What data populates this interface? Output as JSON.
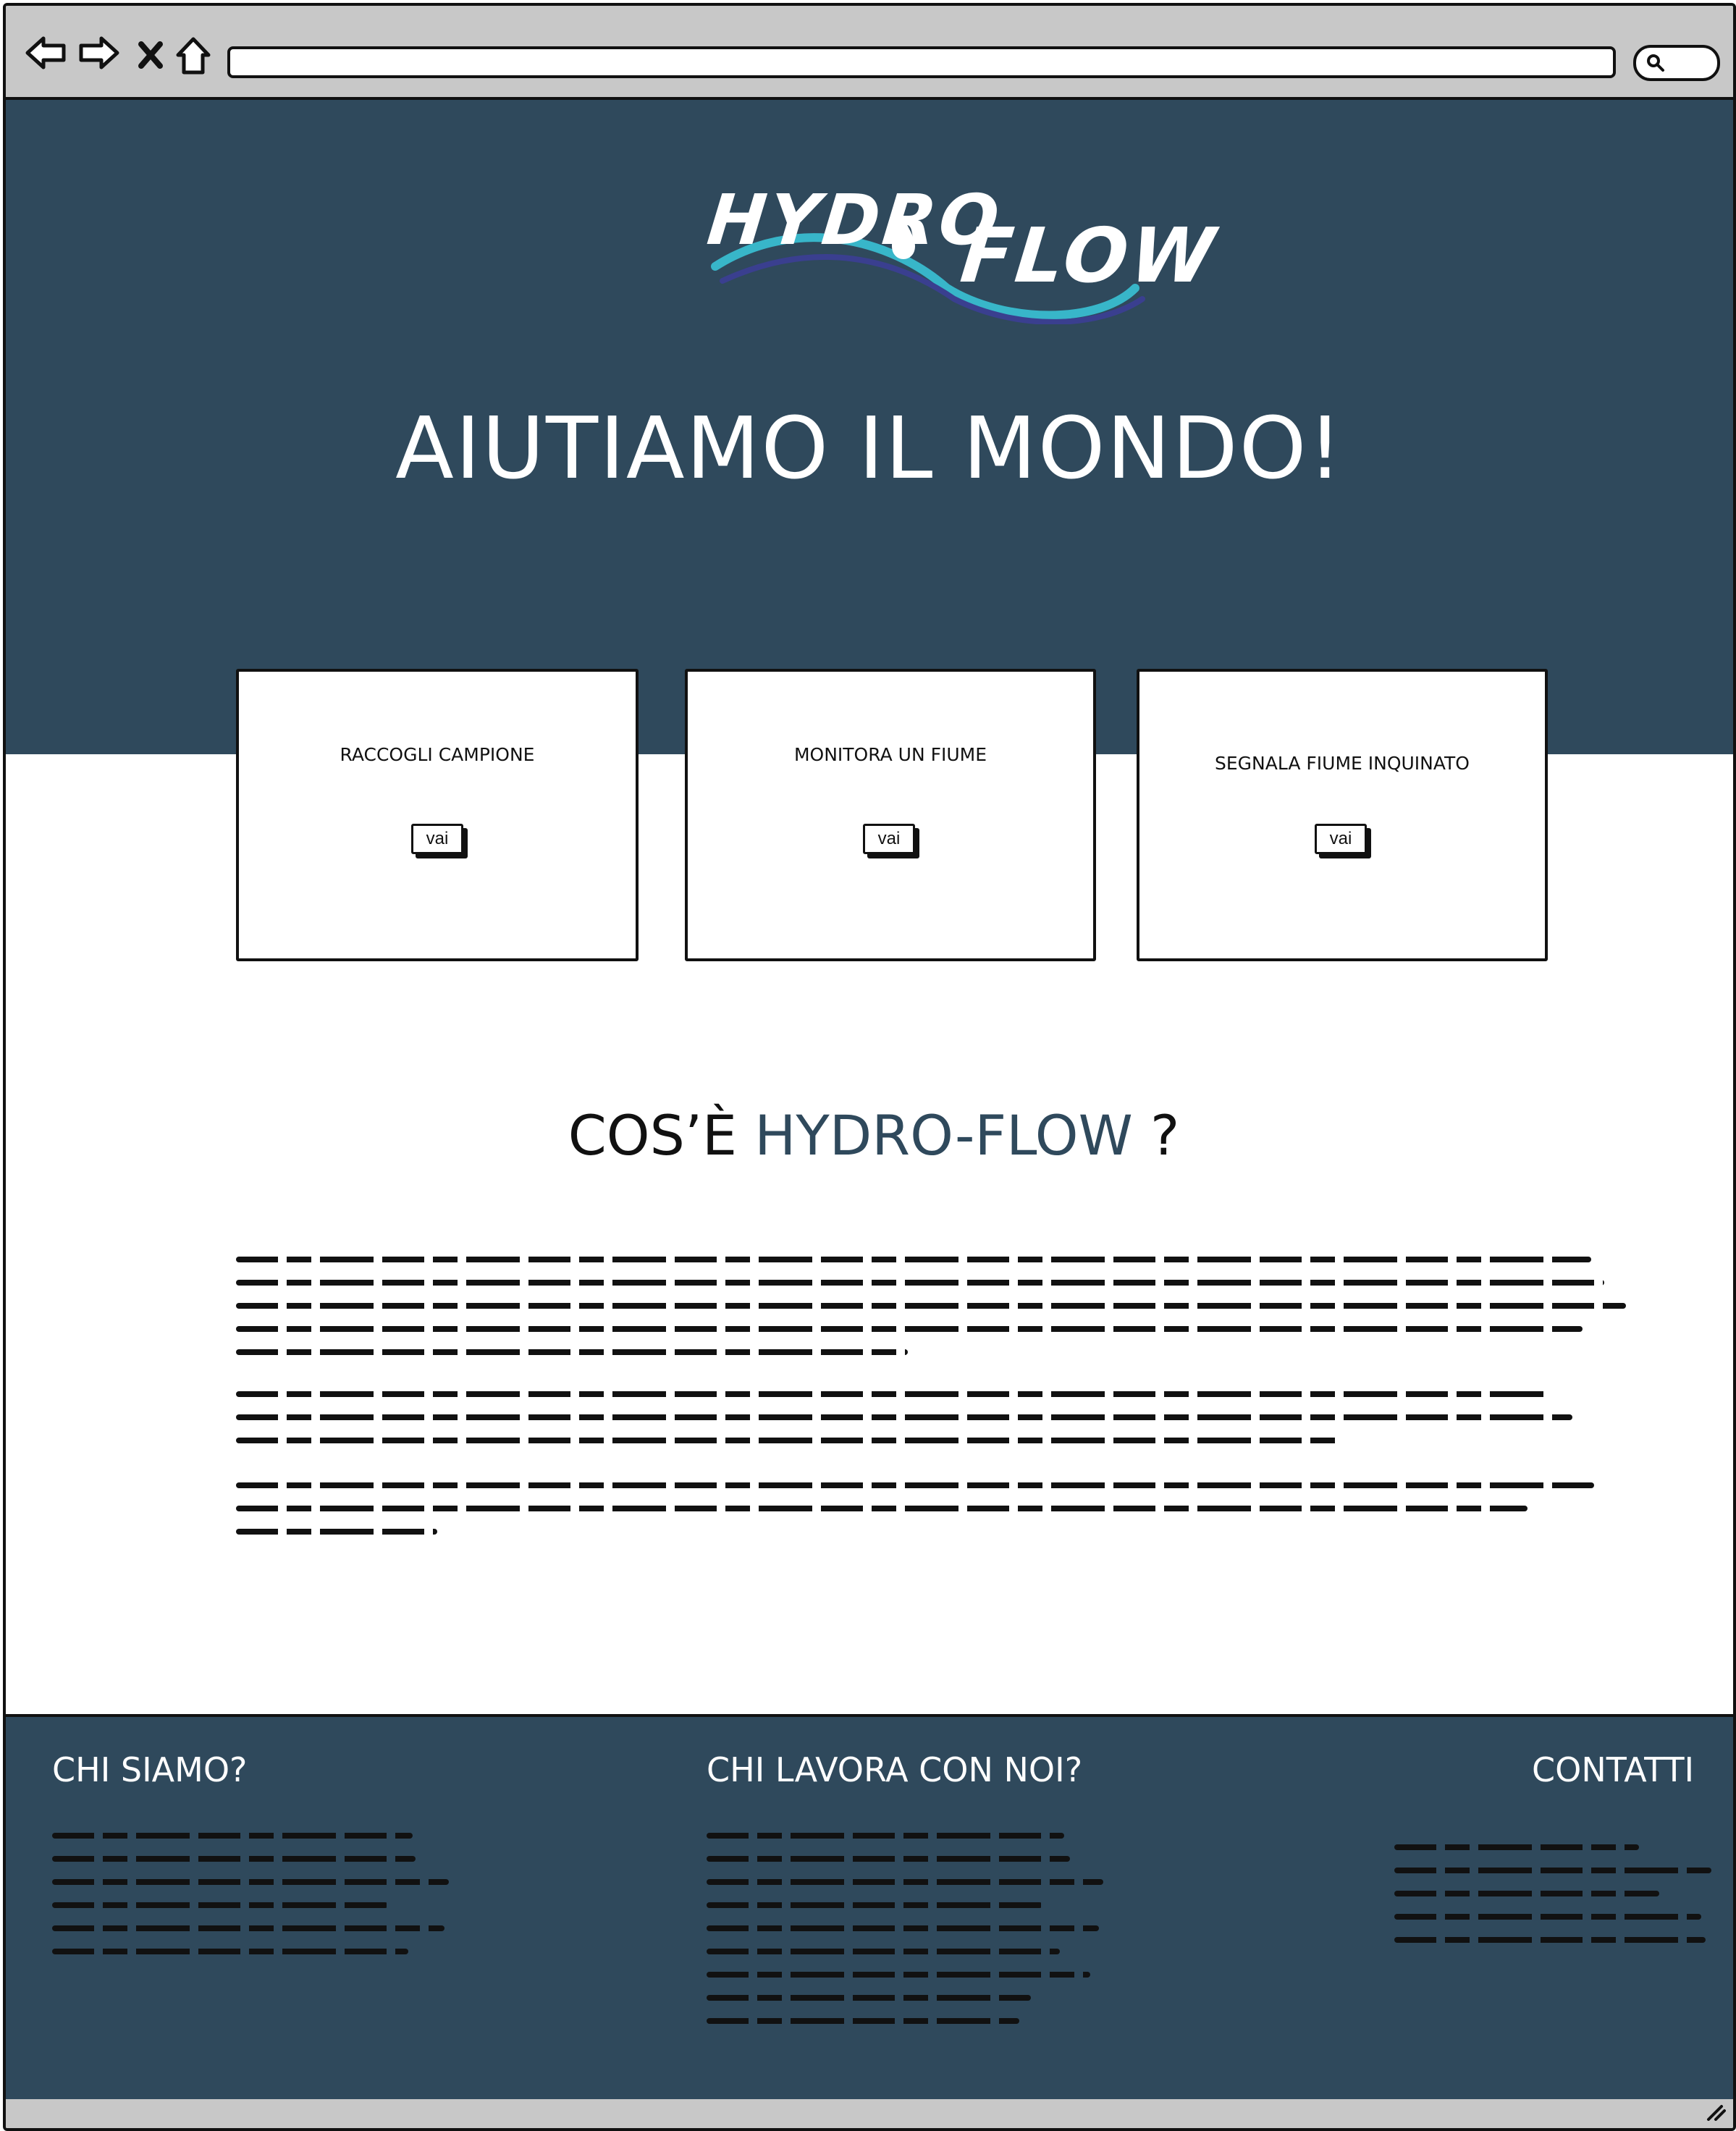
{
  "browser": {
    "nav_icons": [
      "back-arrow-icon",
      "forward-arrow-icon",
      "close-icon",
      "home-icon"
    ],
    "search_icon": "search-icon"
  },
  "logo": {
    "part1": "HYDRO",
    "part2": "FLOW"
  },
  "hero": {
    "title": "AIUTIAMO IL MONDO!"
  },
  "cards": [
    {
      "title": "RACCOGLI CAMPIONE",
      "button": "vai"
    },
    {
      "title": "MONITORA UN FIUME",
      "button": "vai"
    },
    {
      "title": "SEGNALA FIUME INQUINATO",
      "button": "vai"
    }
  ],
  "about": {
    "title_prefix": "COS’È",
    "title_accent": "HYDRO-FLOW",
    "title_suffix": "?"
  },
  "footer": {
    "col1_title": "CHI SIAMO?",
    "col2_title": "CHI LAVORA CON NOI?",
    "col3_title": "CONTATTI"
  },
  "colors": {
    "primary": "#2f495c",
    "chrome": "#c8c8c8",
    "text": "#111111",
    "white": "#ffffff"
  }
}
